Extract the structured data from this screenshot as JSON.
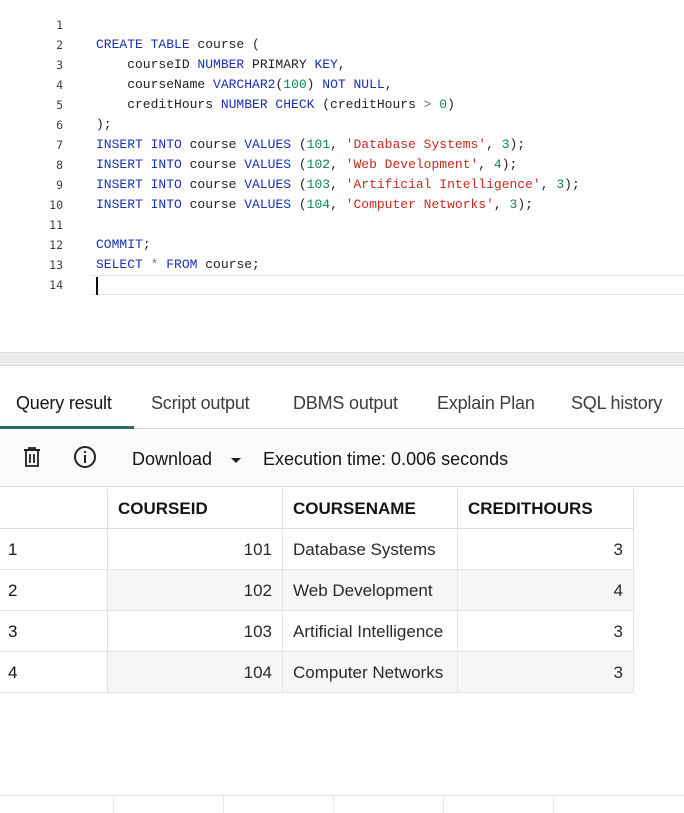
{
  "editor": {
    "lines": [
      {
        "n": "1",
        "tokens": []
      },
      {
        "n": "2",
        "tokens": [
          [
            "kw",
            "CREATE TABLE "
          ],
          [
            "id",
            "course "
          ],
          [
            "punc",
            "("
          ]
        ]
      },
      {
        "n": "3",
        "tokens": [
          [
            "id",
            "    courseID "
          ],
          [
            "kw",
            "NUMBER "
          ],
          [
            "id",
            "PRIMARY "
          ],
          [
            "kw",
            "KEY"
          ],
          [
            "punc",
            ","
          ]
        ]
      },
      {
        "n": "4",
        "tokens": [
          [
            "id",
            "    courseName "
          ],
          [
            "kw",
            "VARCHAR2"
          ],
          [
            "punc",
            "("
          ],
          [
            "num",
            "100"
          ],
          [
            "punc",
            ") "
          ],
          [
            "kw",
            "NOT NULL"
          ],
          [
            "punc",
            ","
          ]
        ]
      },
      {
        "n": "5",
        "tokens": [
          [
            "id",
            "    creditHours "
          ],
          [
            "kw",
            "NUMBER CHECK "
          ],
          [
            "punc",
            "(creditHours "
          ],
          [
            "op",
            "> "
          ],
          [
            "num",
            "0"
          ],
          [
            "punc",
            ")"
          ]
        ]
      },
      {
        "n": "6",
        "tokens": [
          [
            "punc",
            ");"
          ]
        ]
      },
      {
        "n": "7",
        "tokens": [
          [
            "kw",
            "INSERT INTO "
          ],
          [
            "id",
            "course "
          ],
          [
            "kw",
            "VALUES "
          ],
          [
            "punc",
            "("
          ],
          [
            "num",
            "101"
          ],
          [
            "punc",
            ", "
          ],
          [
            "str",
            "'Database Systems'"
          ],
          [
            "punc",
            ", "
          ],
          [
            "num",
            "3"
          ],
          [
            "punc",
            ");"
          ]
        ]
      },
      {
        "n": "8",
        "tokens": [
          [
            "kw",
            "INSERT INTO "
          ],
          [
            "id",
            "course "
          ],
          [
            "kw",
            "VALUES "
          ],
          [
            "punc",
            "("
          ],
          [
            "num",
            "102"
          ],
          [
            "punc",
            ", "
          ],
          [
            "str",
            "'Web Development'"
          ],
          [
            "punc",
            ", "
          ],
          [
            "num",
            "4"
          ],
          [
            "punc",
            ");"
          ]
        ]
      },
      {
        "n": "9",
        "tokens": [
          [
            "kw",
            "INSERT INTO "
          ],
          [
            "id",
            "course "
          ],
          [
            "kw",
            "VALUES "
          ],
          [
            "punc",
            "("
          ],
          [
            "num",
            "103"
          ],
          [
            "punc",
            ", "
          ],
          [
            "str",
            "'Artificial Intelligence'"
          ],
          [
            "punc",
            ", "
          ],
          [
            "num",
            "3"
          ],
          [
            "punc",
            ");"
          ]
        ]
      },
      {
        "n": "10",
        "tokens": [
          [
            "kw",
            "INSERT INTO "
          ],
          [
            "id",
            "course "
          ],
          [
            "kw",
            "VALUES "
          ],
          [
            "punc",
            "("
          ],
          [
            "num",
            "104"
          ],
          [
            "punc",
            ", "
          ],
          [
            "str",
            "'Computer Networks'"
          ],
          [
            "punc",
            ", "
          ],
          [
            "num",
            "3"
          ],
          [
            "punc",
            ");"
          ]
        ]
      },
      {
        "n": "11",
        "tokens": []
      },
      {
        "n": "12",
        "tokens": [
          [
            "kw",
            "COMMIT"
          ],
          [
            "punc",
            ";"
          ]
        ]
      },
      {
        "n": "13",
        "tokens": [
          [
            "kw",
            "SELECT "
          ],
          [
            "op",
            "* "
          ],
          [
            "kw",
            "FROM "
          ],
          [
            "id",
            "course"
          ],
          [
            "punc",
            ";"
          ]
        ]
      },
      {
        "n": "14",
        "tokens": []
      }
    ],
    "colors": {
      "keyword": "#1a2fb5",
      "number": "#098658",
      "string": "#c72a1e"
    }
  },
  "tabs": [
    {
      "label": "Query result",
      "active": true
    },
    {
      "label": "Script output",
      "active": false
    },
    {
      "label": "DBMS output",
      "active": false
    },
    {
      "label": "Explain Plan",
      "active": false
    },
    {
      "label": "SQL history",
      "active": false
    }
  ],
  "toolbar": {
    "delete_icon": "trash-icon",
    "info_icon": "info-icon",
    "download_label": "Download",
    "execution_time": "Execution time: 0.006 seconds"
  },
  "grid": {
    "columns": [
      "COURSEID",
      "COURSENAME",
      "CREDITHOURS"
    ],
    "rows": [
      {
        "num": "1",
        "courseid": "101",
        "coursename": "Database Systems",
        "credithours": "3"
      },
      {
        "num": "2",
        "courseid": "102",
        "coursename": "Web Development",
        "credithours": "4"
      },
      {
        "num": "3",
        "courseid": "103",
        "coursename": "Artificial Intelligence",
        "credithours": "3"
      },
      {
        "num": "4",
        "courseid": "104",
        "coursename": "Computer Networks",
        "credithours": "3"
      }
    ]
  }
}
